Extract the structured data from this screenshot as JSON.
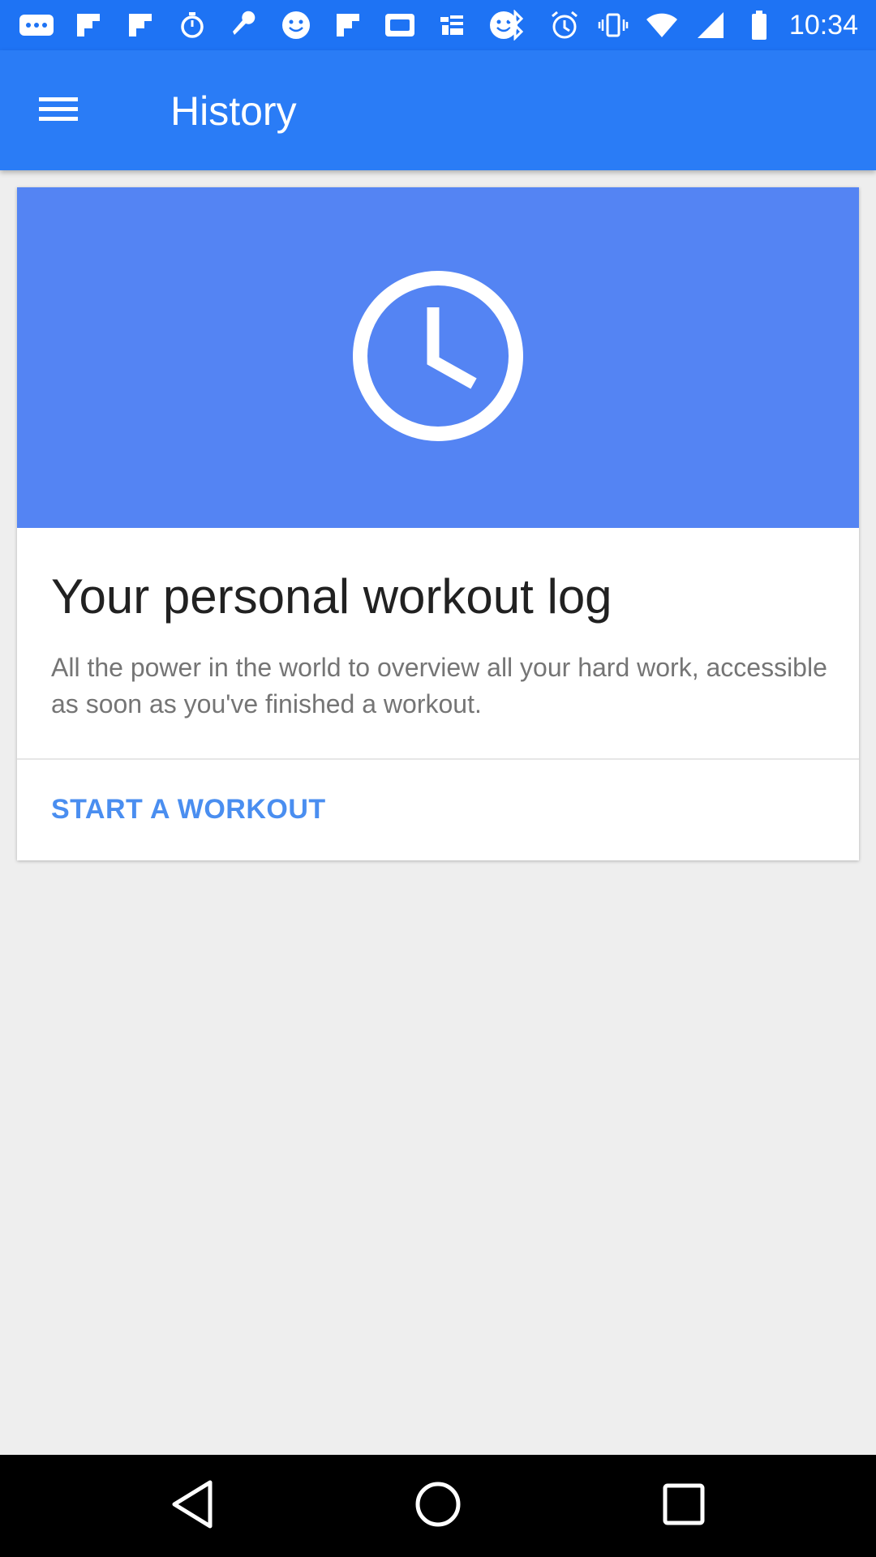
{
  "status_bar": {
    "time": "10:34",
    "left_icons": [
      "more-icon",
      "flipboard-icon",
      "flipboard-icon",
      "stopwatch-icon",
      "wrench-icon",
      "smiley-icon",
      "flipboard-icon",
      "qq-icon",
      "taobao-icon",
      "smiley-icon"
    ],
    "right_icons": [
      "bluetooth-icon",
      "alarm-icon",
      "vibrate-icon",
      "wifi-icon",
      "signal-icon",
      "battery-icon"
    ]
  },
  "app_bar": {
    "title": "History",
    "menu_icon": "menu-icon"
  },
  "card": {
    "hero_icon": "clock-icon",
    "title": "Your personal workout log",
    "body": "All the power in the world to overview all your hard work, accessible as soon as you've finished a workout.",
    "action_label": "START A WORKOUT"
  },
  "nav_bar": {
    "buttons": [
      "back-icon",
      "home-icon",
      "recents-icon"
    ]
  },
  "colors": {
    "status_bar": "#1e73f4",
    "app_bar": "#2a7cf6",
    "hero": "#5484f3",
    "accent": "#4a8ef0",
    "background": "#eeeeee"
  }
}
